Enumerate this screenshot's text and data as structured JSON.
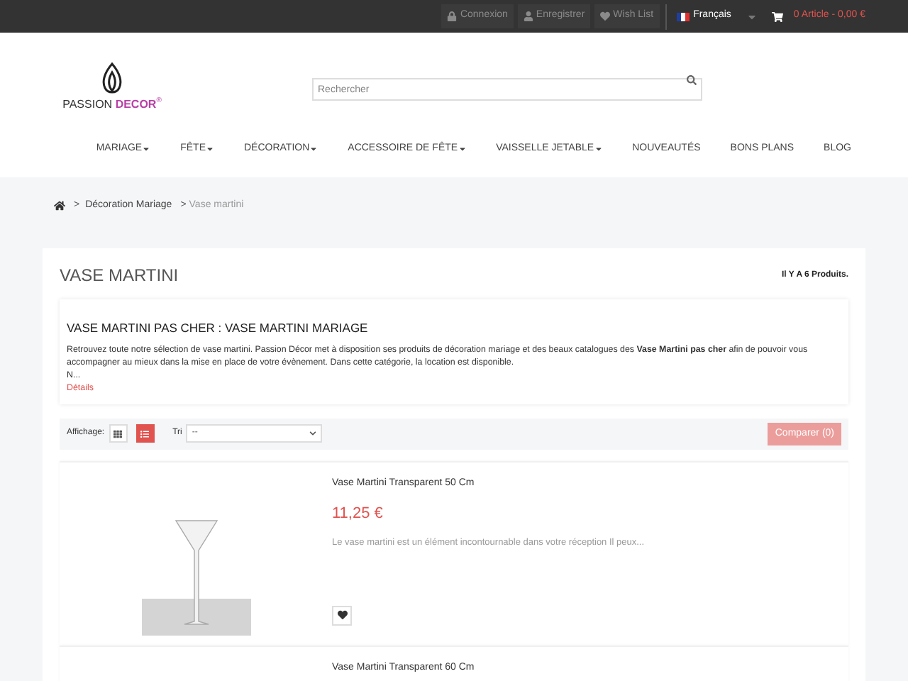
{
  "top_bar": {
    "links": [
      {
        "kind": "lock",
        "label": "Connexion"
      },
      {
        "kind": "user",
        "label": "Enregistrer"
      },
      {
        "kind": "heart",
        "label": "Wish List"
      }
    ],
    "language": "Français",
    "cart": "0 Article - 0,00 €"
  },
  "logo": {
    "name": "PASSION",
    "accent": "DECOR",
    "mark": "®"
  },
  "search": {
    "placeholder": "Rechercher"
  },
  "nav": [
    {
      "label": "MARIAGE",
      "dropdown": true
    },
    {
      "label": "FÊTE",
      "dropdown": true
    },
    {
      "label": "DÉCORATION",
      "dropdown": true
    },
    {
      "label": "ACCESSOIRE DE FÊTE",
      "dropdown": true
    },
    {
      "label": "VAISSELLE JETABLE",
      "dropdown": true
    },
    {
      "label": "NOUVEAUTÉS",
      "dropdown": false
    },
    {
      "label": "BONS PLANS",
      "dropdown": false
    },
    {
      "label": "BLOG",
      "dropdown": false
    }
  ],
  "breadcrumb_separator": ">",
  "breadcrumb": [
    {
      "label": "Décoration Mariage",
      "current": false
    },
    {
      "label": "Vase martini",
      "current": true
    }
  ],
  "category": {
    "title": "VASE MARTINI",
    "count": "Il Y A 6 Produits."
  },
  "description": {
    "heading": "VASE MARTINI PAS CHER : VASE MARTINI MARIAGE",
    "text": "Retrouvez toute notre sélection de vase martini. Passion Décor met à disposition ses produits de décoration mariage et des beaux catalogues des **Vase Martini pas cher**  afin de pouvoir vous accompagner au mieux dans la mise en place de votre évènement. Dans cette catégorie, la location est disponible.",
    "more": "N...",
    "details": "Détails"
  },
  "toolbar": {
    "display_label": "Affichage:",
    "views": [
      {
        "kind": "grid",
        "selected": false
      },
      {
        "kind": "list",
        "selected": true
      }
    ],
    "sort_label": "Tri",
    "sort_value": "--",
    "compare": "Comparer (0)"
  },
  "products": [
    {
      "name": "Vase Martini Transparent 50 Cm",
      "price": "11,25 €",
      "text": "Le vase martini est un élément incontournable dans votre réception Il peux..."
    },
    {
      "name": "Vase Martini Transparent 60 Cm"
    }
  ]
}
